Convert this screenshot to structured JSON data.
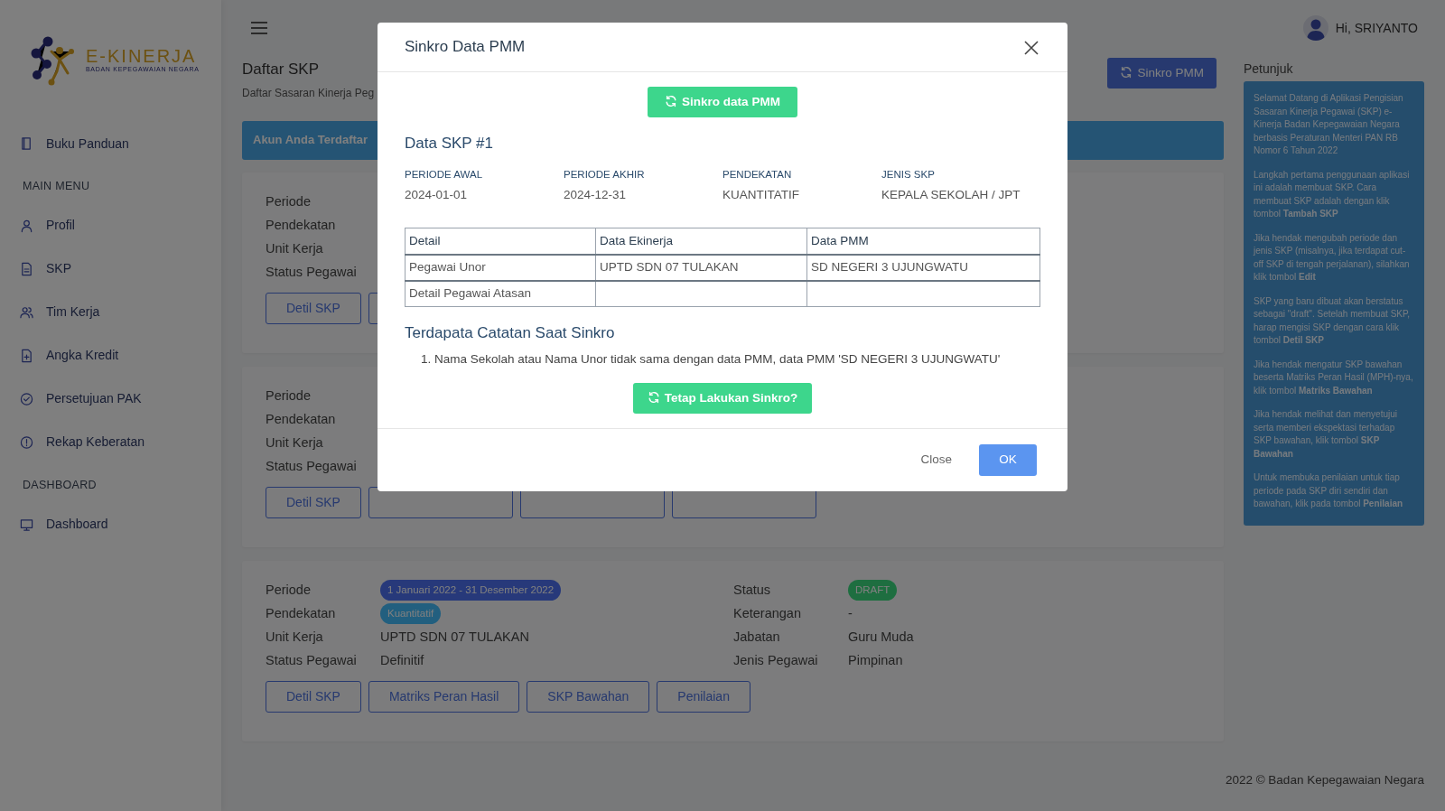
{
  "sidebar": {
    "logo": {
      "title": "E-KINERJA",
      "subtitle": "BADAN KEPEGAWAIAN NEGARA"
    },
    "items": [
      {
        "kind": "link",
        "label": "Buku Panduan"
      },
      {
        "kind": "heading",
        "label": "MAIN MENU"
      },
      {
        "kind": "link",
        "label": "Profil"
      },
      {
        "kind": "link",
        "label": "SKP"
      },
      {
        "kind": "link",
        "label": "Tim Kerja"
      },
      {
        "kind": "link",
        "label": "Angka Kredit"
      },
      {
        "kind": "link",
        "label": "Persetujuan PAK"
      },
      {
        "kind": "link",
        "label": "Rekap Keberatan"
      },
      {
        "kind": "heading",
        "label": "DASHBOARD"
      },
      {
        "kind": "link",
        "label": "Dashboard"
      }
    ]
  },
  "topbar": {
    "user": "Hi, SRIYANTO"
  },
  "page": {
    "title": "Daftar SKP",
    "subtitle": "Daftar Sasaran Kinerja Peg",
    "sync_button": "Sinkro PMM",
    "banner": "Akun Anda Terdaftar"
  },
  "skp_cards": [
    {
      "left": [
        {
          "label": "Periode"
        },
        {
          "label": "Pendekatan"
        },
        {
          "label": "Unit Kerja"
        },
        {
          "label": "Status Pegawai"
        }
      ],
      "buttons": [
        {
          "kind": "text",
          "label": "Detil SKP"
        },
        {
          "kind": "blank"
        }
      ]
    },
    {
      "left": [
        {
          "label": "Periode"
        },
        {
          "label": "Pendekatan"
        },
        {
          "label": "Unit Kerja"
        },
        {
          "label": "Status Pegawai"
        }
      ],
      "buttons": [
        {
          "kind": "text",
          "label": "Detil SKP"
        },
        {
          "kind": "blank"
        },
        {
          "kind": "blank"
        },
        {
          "kind": "blank"
        }
      ]
    },
    {
      "left": [
        {
          "label": "Periode",
          "value": "1 Januari 2022 - 31 Desember 2022",
          "kind": "badge",
          "color": "#27397a"
        },
        {
          "label": "Pendekatan",
          "value": "Kuantitatif",
          "kind": "badge",
          "color": "#225f7f"
        },
        {
          "label": "Unit Kerja",
          "value": "UPTD SDN 07 TULAKAN",
          "kind": "text"
        },
        {
          "label": "Status Pegawai",
          "value": "Definitif",
          "kind": "text"
        }
      ],
      "right": [
        {
          "label": "Status",
          "value": "DRAFT",
          "kind": "badge",
          "color": "#1e6e40"
        },
        {
          "label": "Keterangan",
          "value": "-",
          "kind": "text"
        },
        {
          "label": "Jabatan",
          "value": "Guru Muda",
          "kind": "text"
        },
        {
          "label": "Jenis Pegawai",
          "value": "Pimpinan",
          "kind": "text"
        }
      ],
      "buttons": [
        {
          "kind": "text",
          "label": "Detil SKP"
        },
        {
          "kind": "text",
          "label": "Matriks Peran Hasil"
        },
        {
          "kind": "text",
          "label": "SKP Bawahan"
        },
        {
          "kind": "text",
          "label": "Penilaian"
        }
      ]
    }
  ],
  "petunjuk": {
    "title": "Petunjuk",
    "paragraphs": [
      "Selamat Datang di Aplikasi Pengisian Sasaran Kinerja Pegawai (SKP) e-Kinerja Badan Kepegawaian Negara berbasis Peraturan Menteri PAN RB Nomor 6 Tahun 2022",
      "Langkah pertama penggunaan aplikasi ini adalah membuat SKP. Cara membuat SKP adalah dengan klik tombol **Tambah SKP**",
      "Jika hendak mengubah periode dan jenis SKP (misalnya, jika terdapat cut-off SKP di tengah perjalanan), silahkan klik tombol **Edit**",
      "SKP yang baru dibuat akan berstatus sebagai \"draft\". Setelah membuat SKP, harap mengisi SKP dengan cara klik tombol **Detil SKP**",
      "Jika hendak mengatur SKP bawahan beserta Matriks Peran Hasil (MPH)-nya, klik tombol **Matriks Bawahan**",
      "Jika hendak melihat dan menyetujui serta memberi ekspektasi terhadap SKP bawahan, klik tombol **SKP Bawahan**",
      "Untuk membuka penilaian untuk tiap periode pada SKP diri sendiri dan bawahan, klik pada tombol **Penilaian**"
    ]
  },
  "footer": "2022 © Badan Kepegawaian Negara",
  "modal": {
    "title": "Sinkro Data PMM",
    "sync_button": "Sinkro data PMM",
    "section_title": "Data SKP #1",
    "info": [
      {
        "label": "PERIODE AWAL",
        "value": "2024-01-01"
      },
      {
        "label": "PERIODE AKHIR",
        "value": "2024-12-31"
      },
      {
        "label": "PENDEKATAN",
        "value": "KUANTITATIF"
      },
      {
        "label": "JENIS SKP",
        "value": "KEPALA SEKOLAH / JPT"
      }
    ],
    "table": {
      "columns": [
        "Detail",
        "Data Ekinerja",
        "Data PMM"
      ],
      "rows": [
        [
          "Pegawai Unor",
          "UPTD SDN 07 TULAKAN",
          "SD NEGERI 3 UJUNGWATU"
        ],
        [
          "Detail Pegawai Atasan",
          null,
          null
        ]
      ]
    },
    "notes_title": "Terdapata Catatan Saat Sinkro",
    "notes": [
      {
        "number": "1.",
        "text": "Nama Sekolah atau Nama Unor tidak sama dengan data PMM, data PMM 'SD NEGERI 3 UJUNGWATU'"
      }
    ],
    "confirm_button": "Tetap Lakukan Sinkro?",
    "footer_buttons": [
      {
        "label": "Close",
        "kind": "secondary"
      },
      {
        "label": "OK",
        "kind": "primary"
      }
    ]
  }
}
